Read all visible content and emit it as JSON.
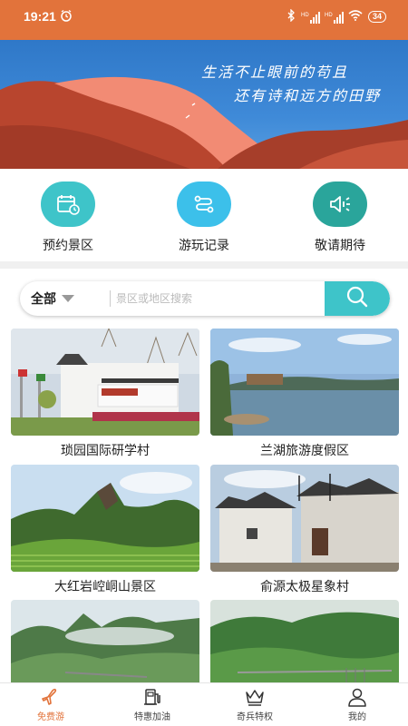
{
  "status_bar": {
    "time": "19:21",
    "battery": "34",
    "network_1": "HD",
    "network_2": "HD"
  },
  "banner": {
    "line1": "生活不止眼前的苟且",
    "line2": "还有诗和远方的田野"
  },
  "quick_actions": [
    {
      "label": "预约景区",
      "icon": "calendar-icon",
      "color": "#3ec4c9"
    },
    {
      "label": "游玩记录",
      "icon": "route-icon",
      "color": "#3cc0ea"
    },
    {
      "label": "敬请期待",
      "icon": "speaker-icon",
      "color": "#2aa59b"
    }
  ],
  "search": {
    "filter": "全部",
    "placeholder": "景区或地区搜索"
  },
  "scenic_spots": [
    {
      "title": "琐园国际研学村"
    },
    {
      "title": "兰湖旅游度假区"
    },
    {
      "title": "大红岩崆峒山景区"
    },
    {
      "title": "俞源太极星象村"
    },
    {
      "title": ""
    },
    {
      "title": ""
    }
  ],
  "tabbar": [
    {
      "label": "免费游",
      "icon": "plane-icon",
      "active": true
    },
    {
      "label": "特惠加油",
      "icon": "fuel-pump-icon",
      "active": false
    },
    {
      "label": "奇兵特权",
      "icon": "crown-icon",
      "active": false
    },
    {
      "label": "我的",
      "icon": "user-icon",
      "active": false
    }
  ],
  "colors": {
    "accent": "#e2733b",
    "teal": "#3ec4c9"
  }
}
